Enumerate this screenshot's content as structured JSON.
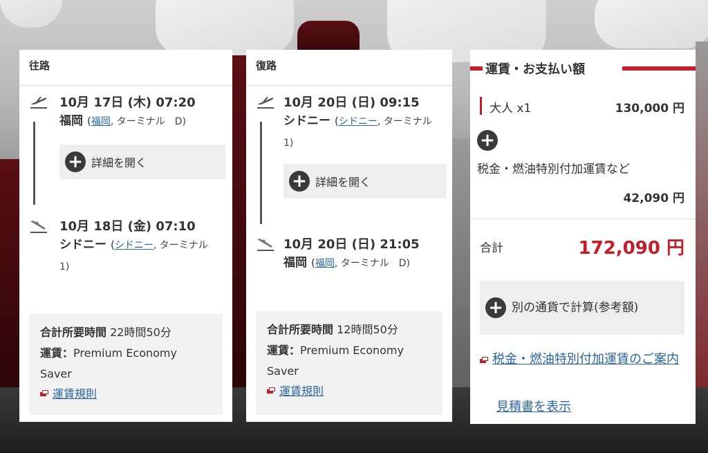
{
  "outbound": {
    "heading": "往路",
    "depart": {
      "time": "10月 17日 (木) 07:20",
      "city": "福岡",
      "airport": "福岡",
      "terminal": ", ターミナル　D)",
      "open": "("
    },
    "expand_label": "詳細を開く",
    "arrive": {
      "time": "10月 18日 (金) 07:10",
      "city": "シドニー",
      "airport": "シドニー",
      "terminal": ", ターミナル　1)",
      "open": "("
    },
    "total_label": "合計所要時間",
    "total_value": "22時間50分",
    "fare_label": "運賃：",
    "fare_value": "Premium Economy Saver",
    "rules_link": "運賃規則"
  },
  "return": {
    "heading": "復路",
    "depart": {
      "time": "10月 20日 (日) 09:15",
      "city": "シドニー",
      "airport": "シドニー",
      "terminal": ", ターミナル　1)",
      "open": "("
    },
    "expand_label": "詳細を開く",
    "arrive": {
      "time": "10月 20日 (日) 21:05",
      "city": "福岡",
      "airport": "福岡",
      "terminal": ", ターミナル　D)",
      "open": "("
    },
    "total_label": "合計所要時間",
    "total_value": "12時間50分",
    "fare_label": "運賃：",
    "fare_value": "Premium Economy Saver",
    "rules_link": "運賃規則"
  },
  "fare": {
    "title": "運賃・お支払い額",
    "adult_label": "大人 x1",
    "adult_amount": "130,000 円",
    "tax_label": "税金・燃油特別付加運賃など",
    "tax_amount": "42,090 円",
    "total_label": "合計",
    "total_amount": "172,090 円",
    "currency_label": "別の通貨で計算(参考額)",
    "tax_info_link": "税金・燃油特別付加運賃のご案内",
    "estimate_link": "見積書を表示"
  },
  "colors": {
    "accent": "#c41e2a",
    "link": "#2a66a0",
    "text": "#333333"
  },
  "icons": [
    "takeoff-icon",
    "landing-icon",
    "plus-icon",
    "external-link-icon"
  ]
}
